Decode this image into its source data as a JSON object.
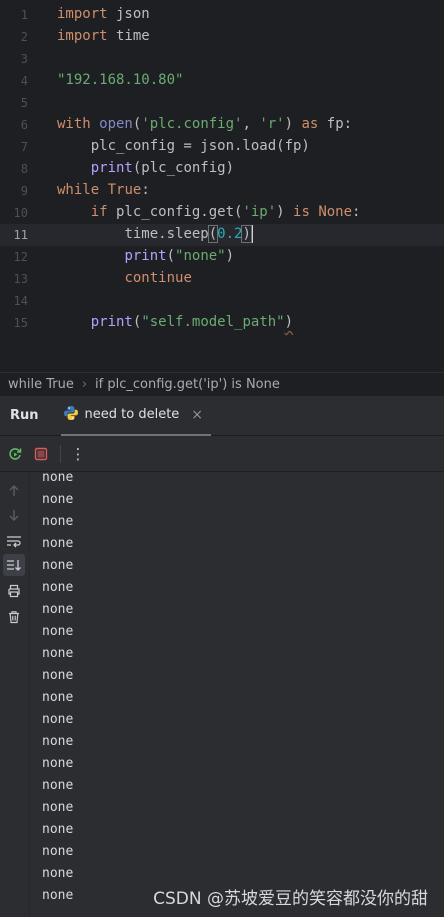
{
  "editor": {
    "current_line": 11,
    "lines": [
      {
        "num": "1"
      },
      {
        "num": "2"
      },
      {
        "num": "3"
      },
      {
        "num": "4"
      },
      {
        "num": "5"
      },
      {
        "num": "6"
      },
      {
        "num": "7"
      },
      {
        "num": "8"
      },
      {
        "num": "9"
      },
      {
        "num": "10"
      },
      {
        "num": "11"
      },
      {
        "num": "12"
      },
      {
        "num": "13"
      },
      {
        "num": "14"
      },
      {
        "num": "15"
      }
    ],
    "code": {
      "l1_kw": "import",
      "l1_rest": " json",
      "l2_kw": "import",
      "l2_rest": " time",
      "l4_str": "\"192.168.10.80\"",
      "l6_kw": "with",
      "l6_fn": " open",
      "l6_p1": "(",
      "l6_s1": "'plc.config'",
      "l6_p2": ", ",
      "l6_s2": "'r'",
      "l6_p3": ") ",
      "l6_kw2": "as",
      "l6_rest": " fp:",
      "l7": "    plc_config = json.load(fp)",
      "l8_ind": "    ",
      "l8_fn": "print",
      "l8_rest": "(plc_config)",
      "l9_kw": "while",
      "l9_sp": " ",
      "l9_kw2": "True",
      "l9_rest": ":",
      "l10_ind": "    ",
      "l10_kw": "if",
      "l10_a": " plc_config.get(",
      "l10_s": "'ip'",
      "l10_b": ") ",
      "l10_kw2": "is",
      "l10_sp": " ",
      "l10_kw3": "None",
      "l10_c": ":",
      "l11_ind": "        ",
      "l11_a": "time.sleep",
      "l11_p1": "(",
      "l11_num": "0.2",
      "l11_p2": ")",
      "l12_ind": "        ",
      "l12_fn": "print",
      "l12_p1": "(",
      "l12_s": "\"none\"",
      "l12_p2": ")",
      "l13_ind": "        ",
      "l13_kw": "continue",
      "l15_ind": "    ",
      "l15_fn": "print",
      "l15_p1": "(",
      "l15_s": "\"self.model_path\"",
      "l15_p2": ")"
    }
  },
  "breadcrumb": {
    "item1": "while True",
    "sep": "›",
    "item2": "if plc_config.get('ip') is None"
  },
  "run_panel": {
    "title": "Run",
    "tab_label": "need to delete",
    "tab_close": "×",
    "more": "⋮"
  },
  "console": {
    "lines": [
      "none",
      "none",
      "none",
      "none",
      "none",
      "none",
      "none",
      "none",
      "none",
      "none",
      "none",
      "none",
      "none",
      "none",
      "none",
      "none",
      "none",
      "none",
      "none",
      "none"
    ]
  },
  "watermark": "CSDN @苏坡爱豆的笑容都没你的甜",
  "colors": {
    "background": "#1e1f22",
    "panel": "#2b2d30",
    "keyword": "#cf8e6d",
    "string": "#6aab73",
    "number": "#2aacb8",
    "builtin_print": "#b6a0ff",
    "rerun_green": "#5fb865",
    "stop_red": "#db5c5c"
  }
}
